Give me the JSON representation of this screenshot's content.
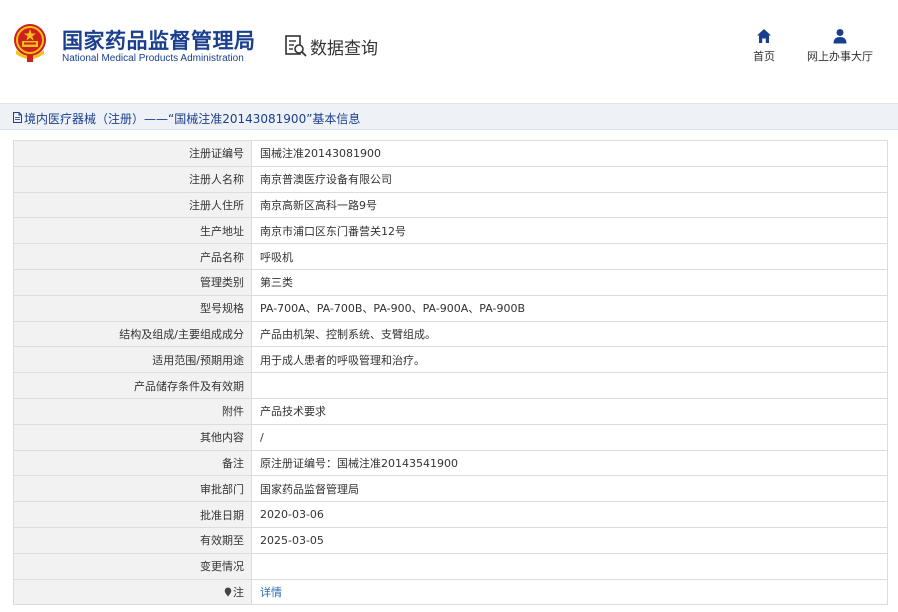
{
  "header": {
    "org_name_cn": "国家药品监督管理局",
    "org_name_en": "National Medical Products Administration",
    "query_label": "数据查询",
    "nav": {
      "home_label": "首页",
      "office_label": "网上办事大厅"
    },
    "colors": {
      "brand": "#1a3f8e",
      "emblem_red": "#d0201b",
      "emblem_gold": "#f2c21a"
    }
  },
  "breadcrumb": {
    "text": "境内医疗器械（注册）——“国械注准20143081900”基本信息"
  },
  "details": {
    "rows": [
      {
        "label": "注册证编号",
        "value": "国械注准20143081900"
      },
      {
        "label": "注册人名称",
        "value": "南京普澳医疗设备有限公司"
      },
      {
        "label": "注册人住所",
        "value": "南京高新区高科一路9号"
      },
      {
        "label": "生产地址",
        "value": "南京市浦口区东门番营关12号"
      },
      {
        "label": "产品名称",
        "value": "呼吸机"
      },
      {
        "label": "管理类别",
        "value": "第三类"
      },
      {
        "label": "型号规格",
        "value": "PA-700A、PA-700B、PA-900、PA-900A、PA-900B"
      },
      {
        "label": "结构及组成/主要组成成分",
        "value": "产品由机架、控制系统、支臂组成。"
      },
      {
        "label": "适用范围/预期用途",
        "value": "用于成人患者的呼吸管理和治疗。"
      },
      {
        "label": "产品储存条件及有效期",
        "value": ""
      },
      {
        "label": "附件",
        "value": "产品技术要求"
      },
      {
        "label": "其他内容",
        "value": "/"
      },
      {
        "label": "备注",
        "value": "原注册证编号：国械注准20143541900"
      },
      {
        "label": "审批部门",
        "value": "国家药品监督管理局"
      },
      {
        "label": "批准日期",
        "value": "2020-03-06"
      },
      {
        "label": "有效期至",
        "value": "2025-03-05"
      },
      {
        "label": "变更情况",
        "value": ""
      },
      {
        "label": "注",
        "value": "详情",
        "label_icon": "pin-icon"
      }
    ]
  }
}
